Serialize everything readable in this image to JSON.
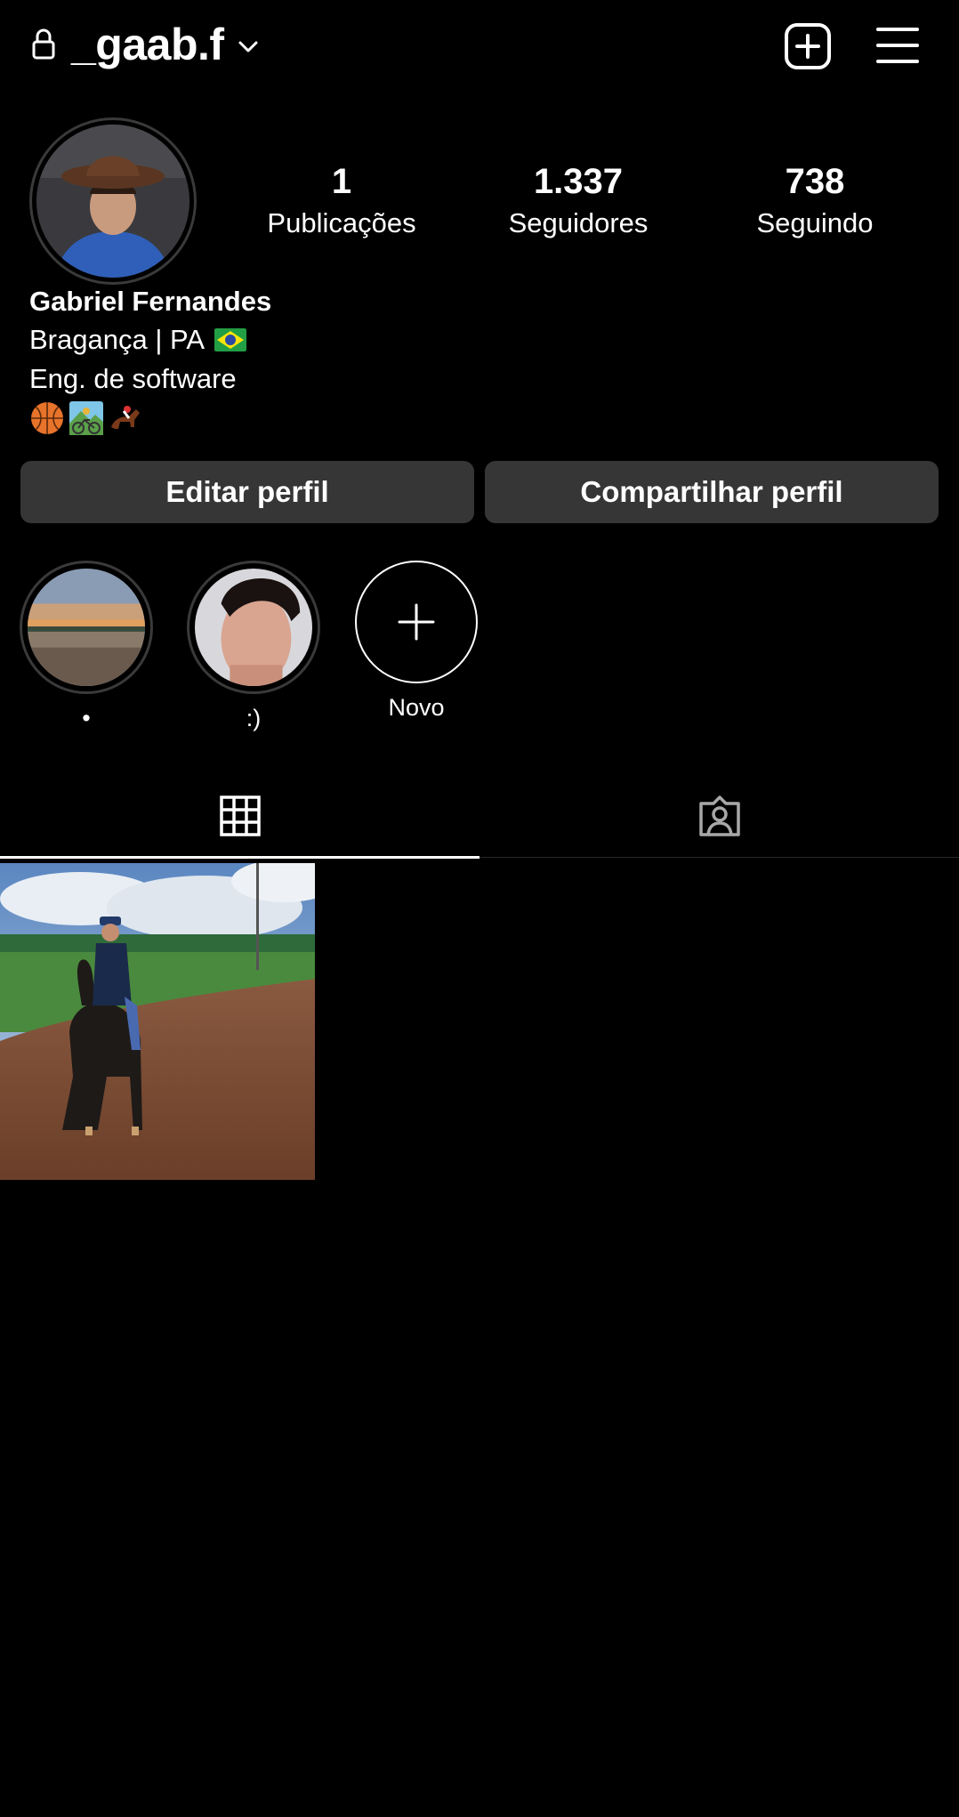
{
  "header": {
    "username": "_gaab.f",
    "lock_icon": "lock-icon",
    "chevron_icon": "chevron-down-icon",
    "new_post_icon": "plus-square-icon",
    "menu_icon": "hamburger-menu-icon"
  },
  "stats": [
    {
      "value": "1",
      "label": "Publicações"
    },
    {
      "value": "1.337",
      "label": "Seguidores"
    },
    {
      "value": "738",
      "label": "Seguindo"
    }
  ],
  "bio": {
    "name": "Gabriel Fernandes",
    "location": "Bragança | PA",
    "occupation": "Eng. de software",
    "emojis": [
      "basketball-icon",
      "mountain-bike-icon",
      "horse-racing-icon"
    ]
  },
  "buttons": {
    "edit_profile": "Editar perfil",
    "share_profile": "Compartilhar perfil"
  },
  "highlights": [
    {
      "label": "•"
    },
    {
      "label": ":)"
    },
    {
      "label": "Novo"
    }
  ],
  "tabs": [
    {
      "icon": "grid-icon",
      "selected": true
    },
    {
      "icon": "tagged-user-icon",
      "selected": false
    }
  ],
  "colors": {
    "background": "#000000",
    "button_bg": "#363636",
    "text": "#ffffff",
    "divider": "#262626"
  }
}
